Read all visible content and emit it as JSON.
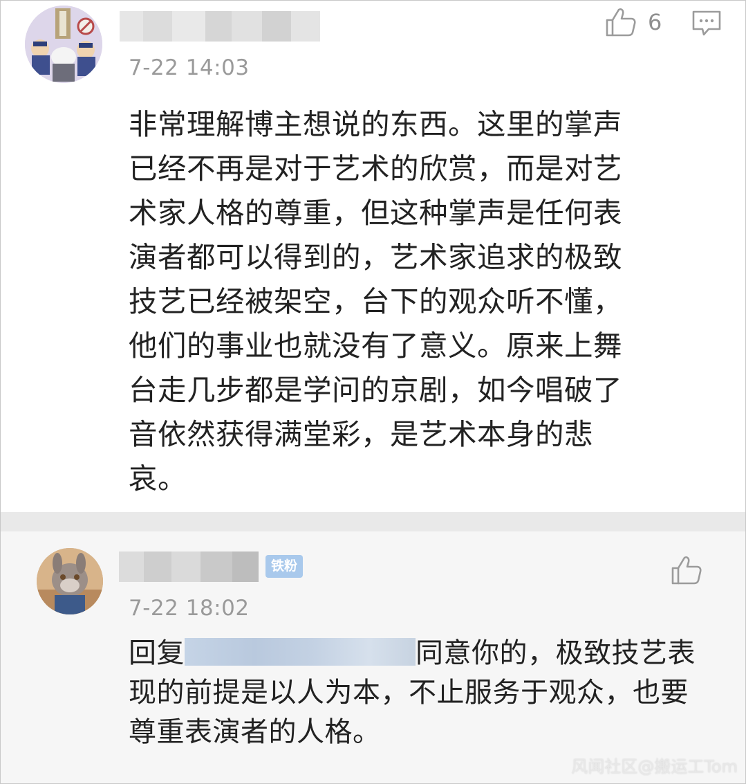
{
  "comments": [
    {
      "username_hidden": true,
      "time": "7-22 14:03",
      "likes": "6",
      "text": "非常理解博主想说的东西。这里的掌声已经不再是对于艺术的欣赏，而是对艺术家人格的尊重，但这种掌声是任何表演者都可以得到的，艺术家追求的极致技艺已经被架空，台下的观众听不懂，他们的事业也就没有了意义。原来上舞台走几步都是学问的京剧，如今唱破了音依然获得满堂彩，是艺术本身的悲哀。",
      "lines": [
        "非常理解博主想说的东西。这里的掌声",
        "已经不再是对于艺术的欣赏，而是对艺",
        "术家人格的尊重，但这种掌声是任何表",
        "演者都可以得到的，艺术家追求的极致",
        "技艺已经被架空，台下的观众听不懂，",
        "他们的事业也就没有了意义。原来上舞",
        "台走几步都是学问的京剧，如今唱破了",
        "音依然获得满堂彩，是艺术本身的悲",
        "哀。"
      ]
    },
    {
      "username_hidden": true,
      "badge": "铁粉",
      "time": "7-22 18:02",
      "reply_prefix": "回复",
      "reply_text_after_mention": "同意你的，极致技艺表",
      "lines": [
        "现的前提是以人为本，不止服务于观众，也要",
        "尊重表演者的人格。"
      ]
    }
  ],
  "watermark": "风闻社区@搬运工Tom",
  "icons": {
    "like": "thumbs-up-icon",
    "comment": "comment-bubble-icon"
  },
  "colors": {
    "text": "#222222",
    "time": "#9a9a9a",
    "badge_bg": "#a9c9ec",
    "icon": "#9b9b9b"
  }
}
